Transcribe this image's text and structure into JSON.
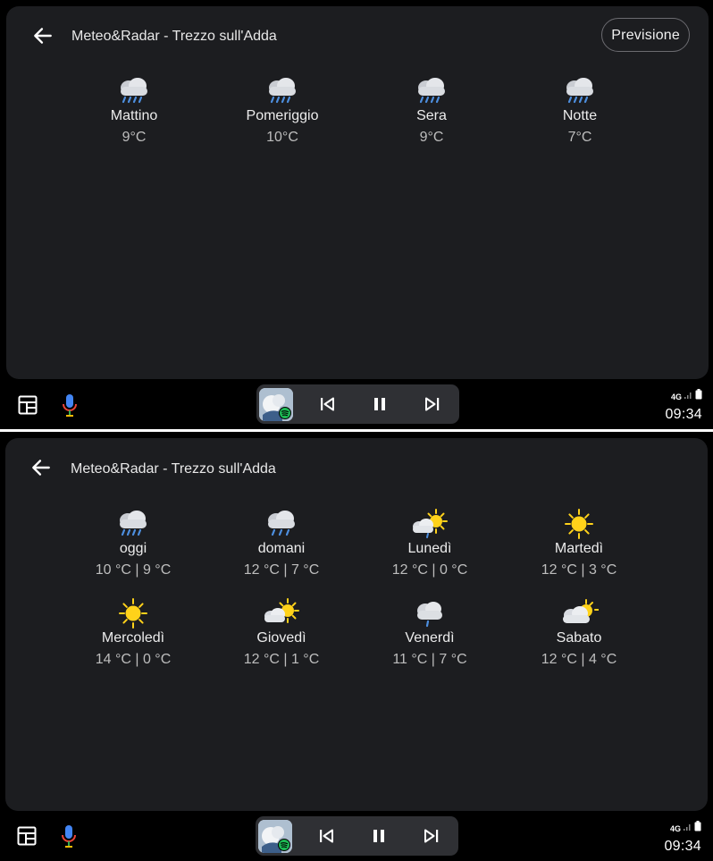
{
  "top": {
    "app_title": "Meteo&Radar - Trezzo sull'Adda",
    "forecast_button": "Previsione",
    "periods": [
      {
        "name": "Mattino",
        "temp": "9°C",
        "icon": "rain-cloud-icon"
      },
      {
        "name": "Pomeriggio",
        "temp": "10°C",
        "icon": "rain-cloud-icon"
      },
      {
        "name": "Sera",
        "temp": "9°C",
        "icon": "rain-cloud-icon"
      },
      {
        "name": "Notte",
        "temp": "7°C",
        "icon": "rain-cloud-icon"
      }
    ]
  },
  "bottom": {
    "app_title": "Meteo&Radar - Trezzo sull'Adda",
    "days": [
      {
        "name": "oggi",
        "temp": "10 °C | 9 °C",
        "icon": "rain-cloud-icon"
      },
      {
        "name": "domani",
        "temp": "12 °C | 7 °C",
        "icon": "rain-cloud-icon"
      },
      {
        "name": "Lunedì",
        "temp": "12 °C | 0 °C",
        "icon": "sun-cloud-rain-icon"
      },
      {
        "name": "Martedì",
        "temp": "12 °C | 3 °C",
        "icon": "sun-icon"
      },
      {
        "name": "Mercoledì",
        "temp": "14 °C | 0 °C",
        "icon": "sun-icon"
      },
      {
        "name": "Giovedì",
        "temp": "12 °C | 1 °C",
        "icon": "sun-cloud-icon"
      },
      {
        "name": "Venerdì",
        "temp": "11 °C | 7 °C",
        "icon": "light-rain-cloud-icon"
      },
      {
        "name": "Sabato",
        "temp": "12 °C | 4 °C",
        "icon": "cloud-sun-icon"
      }
    ]
  },
  "status": {
    "network": "4G",
    "time": "09:34"
  },
  "colors": {
    "background": "#000000",
    "card": "#1c1d20",
    "player": "#2f3034",
    "sun": "#ffd21a",
    "spotify": "#1db954"
  }
}
